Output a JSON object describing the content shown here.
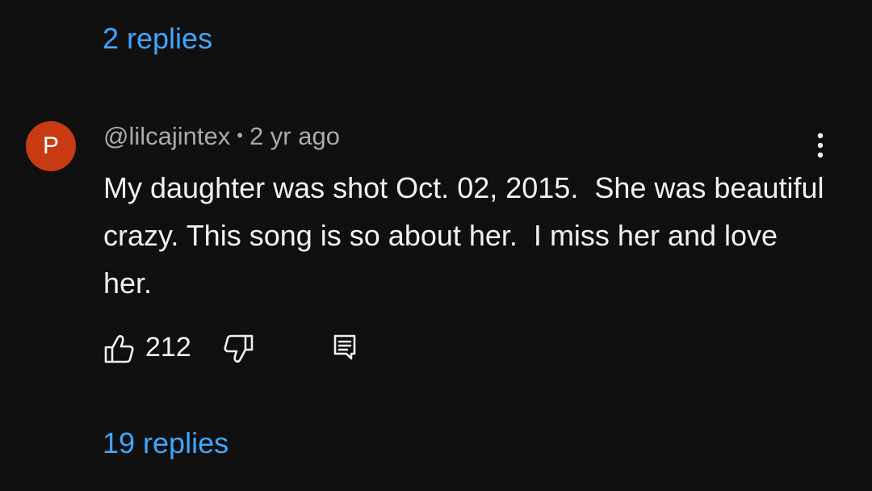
{
  "replies_above": {
    "label": "2 replies"
  },
  "comment": {
    "avatar_letter": "P",
    "avatar_color": "#c83a12",
    "author": "@lilcajintex",
    "separator": "•",
    "time": "2 yr ago",
    "text": "My daughter was shot Oct. 02, 2015.  She was beautiful crazy. This song is so about her.  I miss her and love her.",
    "like_count": "212",
    "icons": {
      "like": "thumbs-up-icon",
      "dislike": "thumbs-down-icon",
      "reply": "reply-comment-icon",
      "menu": "more-vertical-icon"
    }
  },
  "replies_below": {
    "label": "19 replies"
  },
  "colors": {
    "background": "#0f0f0f",
    "link": "#3ea6ff",
    "text": "#f1f1f1",
    "meta": "#aaaaaa"
  }
}
